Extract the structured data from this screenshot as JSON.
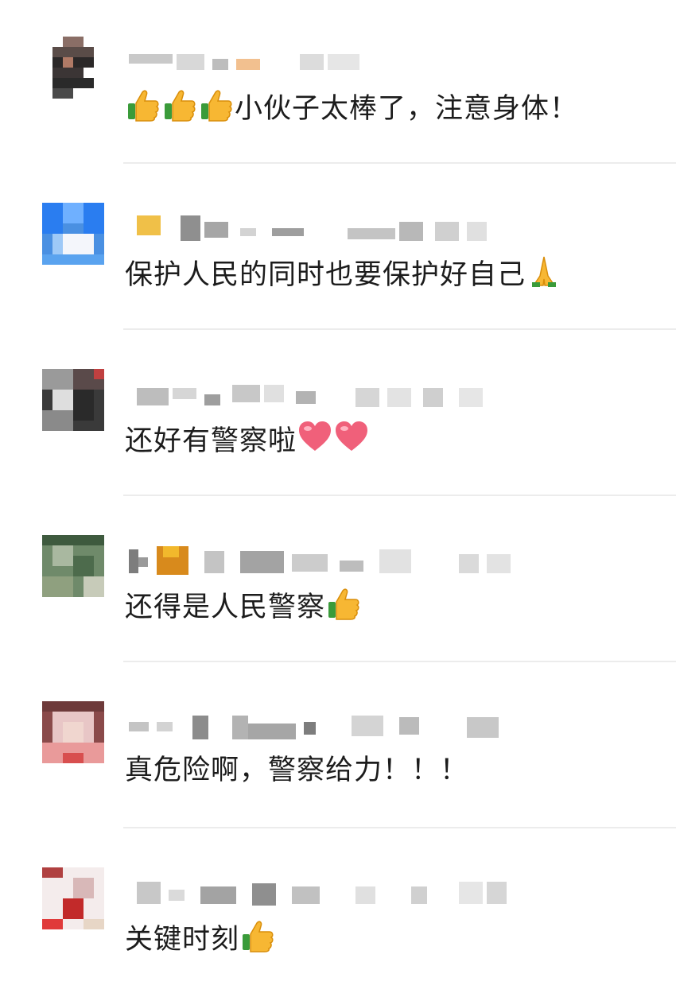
{
  "comments": [
    {
      "text": "小伙子太棒了，注意身体！",
      "emoji": [
        "thumbs-up-icon",
        "thumbs-up-icon",
        "thumbs-up-icon"
      ],
      "emoji_position": "before"
    },
    {
      "text": "保护人民的同时也要保护好自己",
      "emoji": [
        "folded-hands-icon"
      ],
      "emoji_position": "after"
    },
    {
      "text": "还好有警察啦",
      "emoji": [
        "red-heart-icon",
        "red-heart-icon"
      ],
      "emoji_position": "after"
    },
    {
      "text": "还得是人民警察",
      "emoji": [
        "thumbs-up-icon"
      ],
      "emoji_position": "after"
    },
    {
      "text": "真危险啊，警察给力！！！",
      "emoji": [],
      "emoji_position": "after"
    },
    {
      "text": "关键时刻",
      "emoji": [
        "thumbs-up-icon"
      ],
      "emoji_position": "after"
    }
  ],
  "colors": {
    "background": "#ffffff",
    "text": "#1c1c1c",
    "divider": "#ececec",
    "blur_gray": "#c8c8c8"
  }
}
